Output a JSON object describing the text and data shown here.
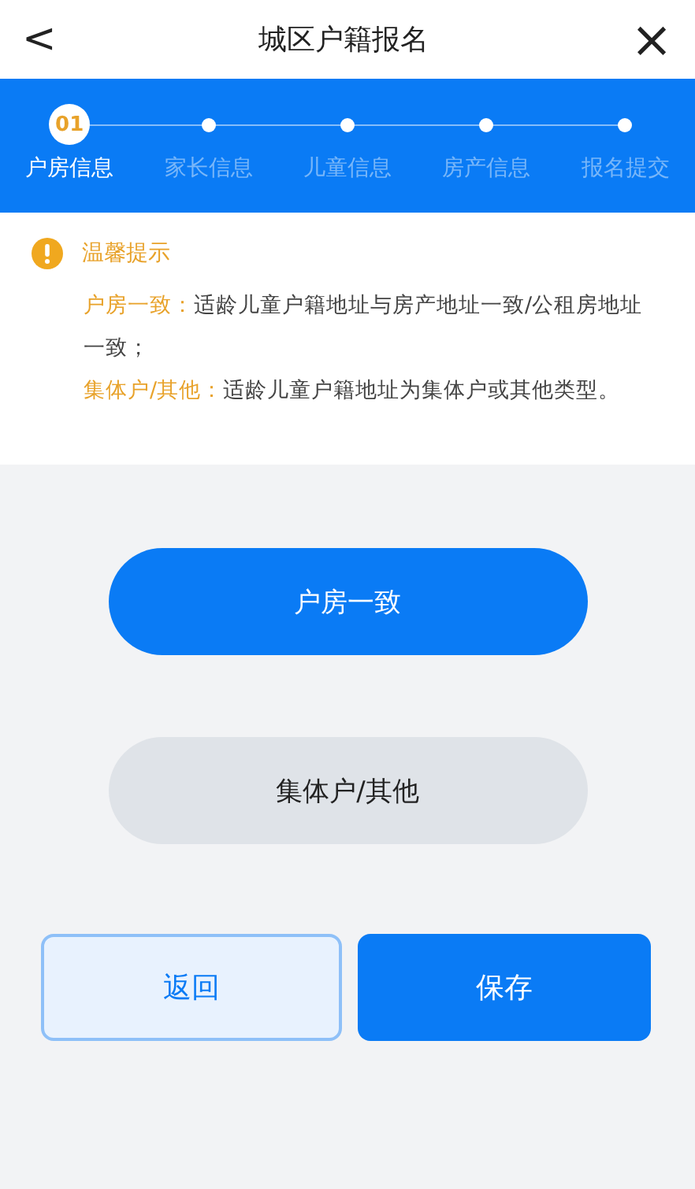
{
  "header": {
    "back": "<",
    "title": "城区户籍报名",
    "close": "×"
  },
  "steps": [
    {
      "label": "户房信息",
      "number": "01",
      "selected": true
    },
    {
      "label": "家长信息",
      "selected": false
    },
    {
      "label": "儿童信息",
      "selected": false
    },
    {
      "label": "房产信息",
      "selected": false
    },
    {
      "label": "报名提交",
      "selected": false
    }
  ],
  "notice": {
    "title": "温馨提示",
    "items": [
      {
        "term": "户房一致：",
        "text": "适龄儿童户籍地址与房产地址一致/公租房地址一致；"
      },
      {
        "term": "集体户/其他：",
        "text": "适龄儿童户籍地址为集体户或其他类型。"
      }
    ]
  },
  "options": [
    {
      "label": "户房一致",
      "selected": true
    },
    {
      "label": "集体户/其他",
      "selected": false
    }
  ],
  "actions": [
    {
      "label": "返回",
      "kind": "secondary"
    },
    {
      "label": "保存",
      "kind": "primary"
    }
  ]
}
